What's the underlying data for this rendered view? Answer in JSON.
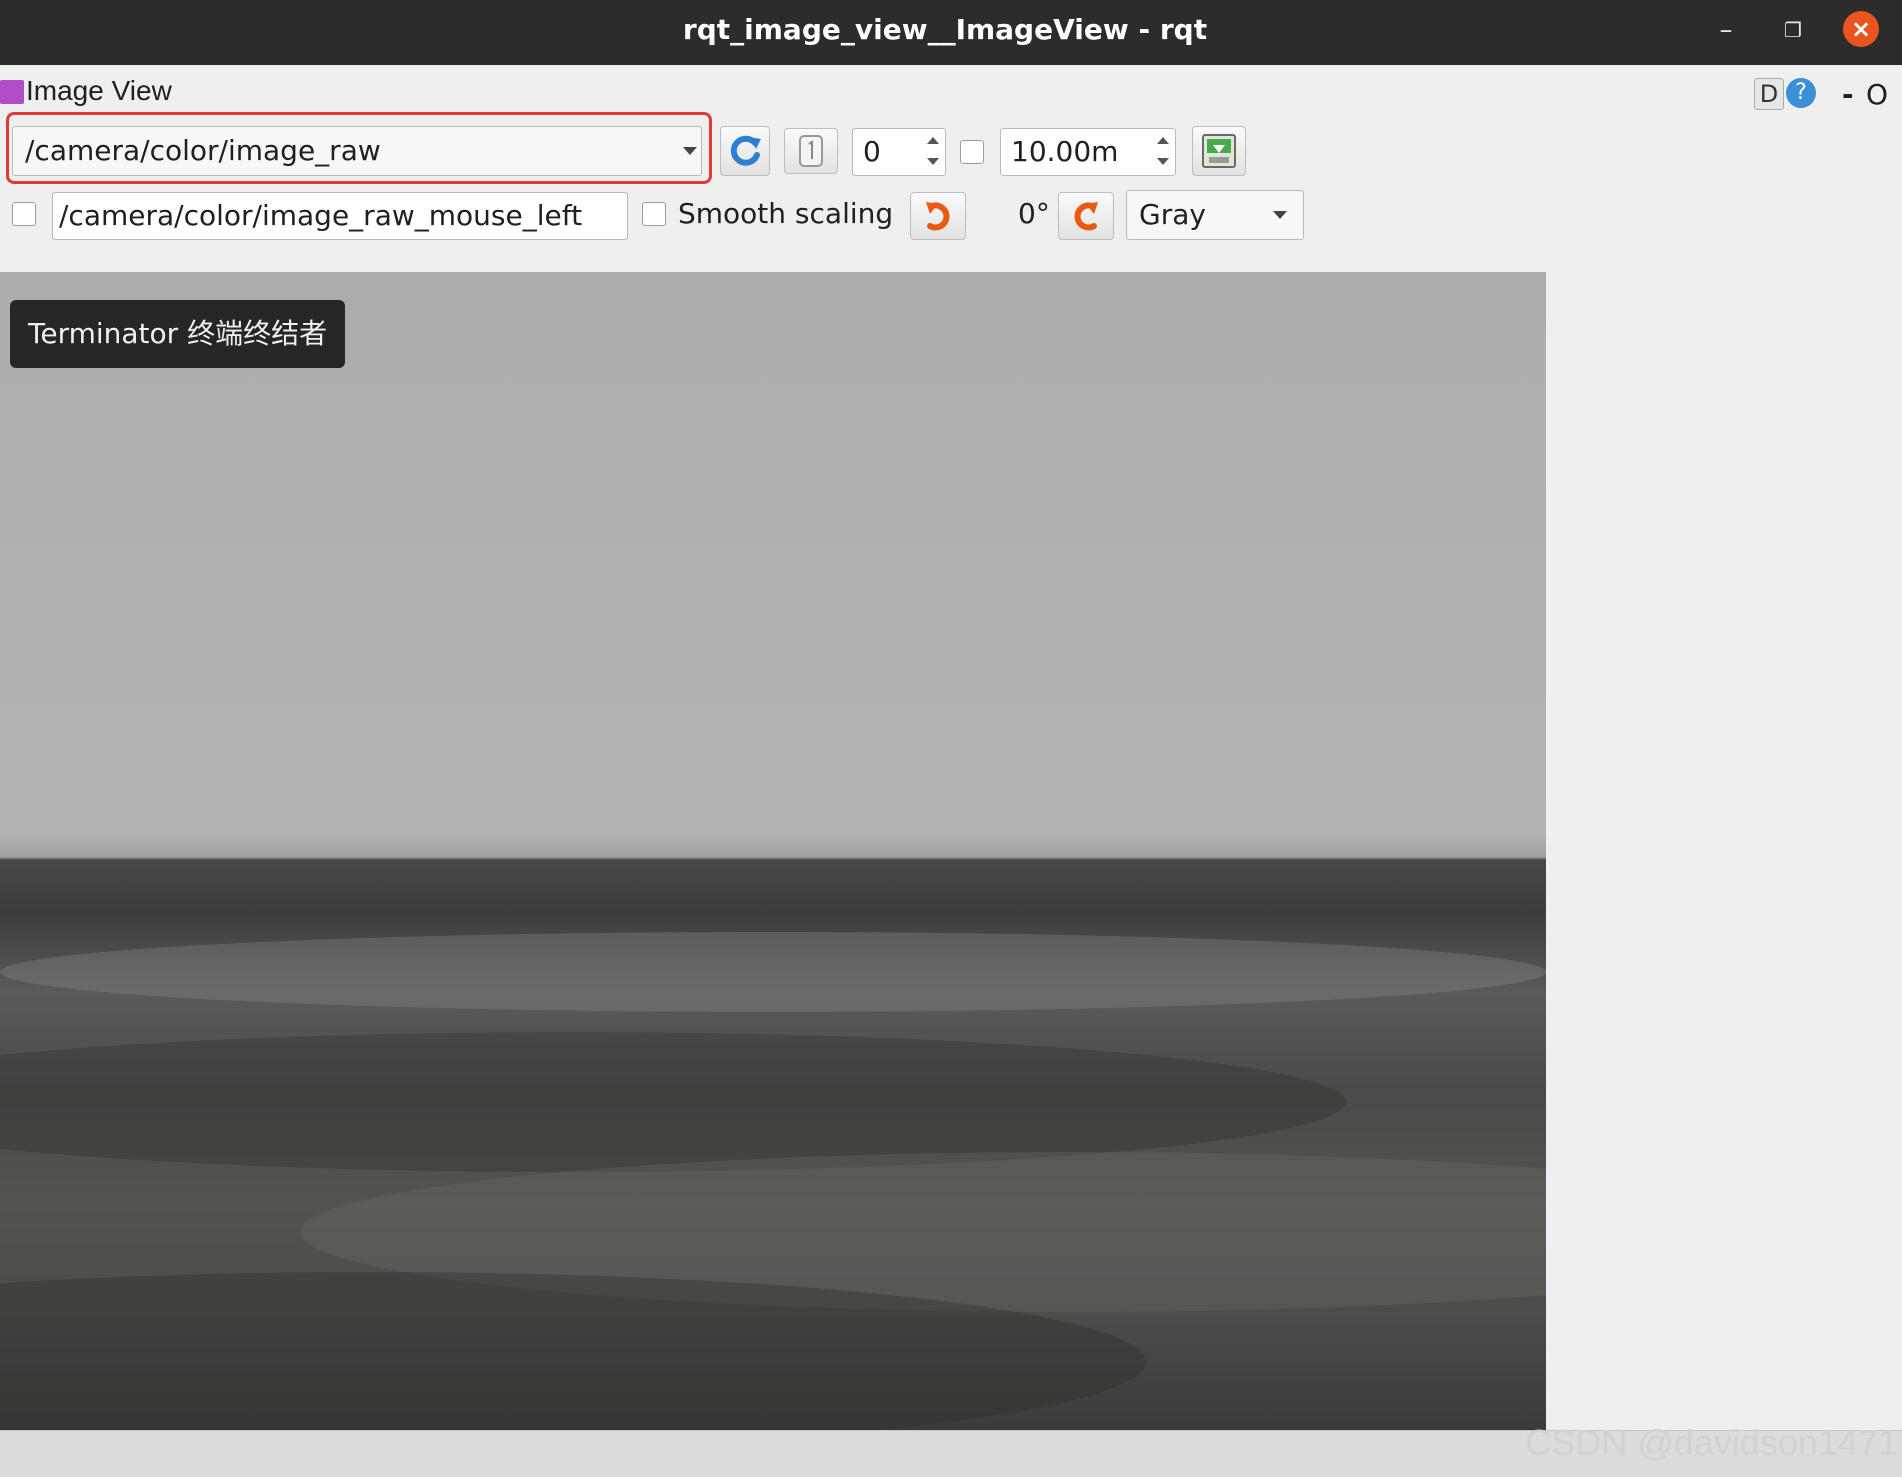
{
  "window": {
    "title": "rqt_image_view__ImageView - rqt",
    "minimize_glyph": "–",
    "maximize_glyph": "❐",
    "close_glyph": "×"
  },
  "plugin": {
    "title": "Image View",
    "help_d": "D",
    "help_q": "?",
    "dash": "-",
    "close": "O"
  },
  "toolbar": {
    "topic": "/camera/color/image_raw",
    "frame_index": "0",
    "max_range": "10.00m"
  },
  "options": {
    "mouse_topic": "/camera/color/image_raw_mouse_left",
    "smooth_scaling_label": "Smooth scaling",
    "rotation": "0°",
    "color_scheme": "Gray"
  },
  "tooltip": {
    "text": "Terminator 终端终结者"
  },
  "watermark": {
    "text": "CSDN @davidson1471"
  },
  "colors": {
    "highlight": "#e03a30",
    "close_button": "#e95420",
    "rotate_icon": "#e85a10",
    "refresh_icon": "#2f7fd0"
  },
  "icons": {
    "refresh": "refresh-icon",
    "zoom_one": "zoom-one-icon",
    "save": "save-image-icon",
    "rotate_left": "rotate-left-icon",
    "rotate_right": "rotate-right-icon"
  }
}
